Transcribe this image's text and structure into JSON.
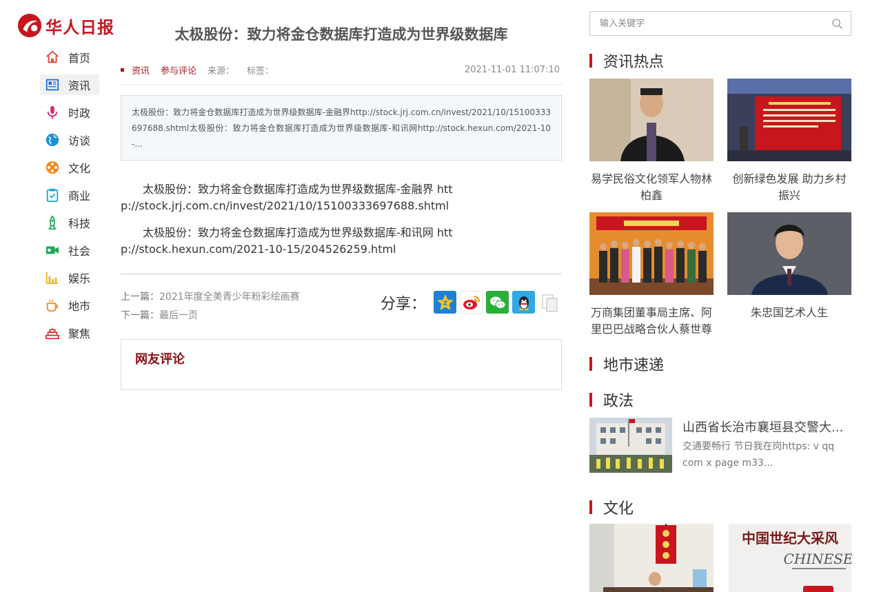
{
  "brand": {
    "name": "华人日报",
    "color": "#c8161e"
  },
  "nav": {
    "items": [
      {
        "label": "首页",
        "icon": "home-icon",
        "color": "#e2442b",
        "active": false
      },
      {
        "label": "资讯",
        "icon": "newspaper-icon",
        "color": "#1e6fd9",
        "active": true
      },
      {
        "label": "时政",
        "icon": "microphone-icon",
        "color": "#d6246e",
        "active": false
      },
      {
        "label": "访谈",
        "icon": "globe-icon",
        "color": "#1e8fd9",
        "active": false
      },
      {
        "label": "文化",
        "icon": "film-reel-icon",
        "color": "#f08a24",
        "active": false
      },
      {
        "label": "商业",
        "icon": "clipboard-check-icon",
        "color": "#1ba3d9",
        "active": false
      },
      {
        "label": "科技",
        "icon": "rocket-icon",
        "color": "#26a65b",
        "active": false
      },
      {
        "label": "社会",
        "icon": "video-camera-icon",
        "color": "#26a65b",
        "active": false
      },
      {
        "label": "娱乐",
        "icon": "bar-chart-icon",
        "color": "#e6b422",
        "active": false
      },
      {
        "label": "地市",
        "icon": "coffee-cup-icon",
        "color": "#f08a24",
        "active": false
      },
      {
        "label": "聚焦",
        "icon": "tiered-cake-icon",
        "color": "#d9262e",
        "active": false
      }
    ]
  },
  "article": {
    "title": "太极股份：致力将金仓数据库打造成为世界级数据库",
    "category": "资讯",
    "comment_link": "参与评论",
    "source_label": "来源：",
    "tags_label": "标签：",
    "date": "2021-11-01 11:07:10",
    "summary": "太极股份：致力将金仓数据库打造成为世界级数据库-金融界http://stock.jrj.com.cn/invest/2021/10/15100333697688.shtml太极股份：致力将金仓数据库打造成为世界级数据库-和讯网http://stock.hexun.com/2021-10-...",
    "paragraphs": [
      "太极股份：致力将金仓数据库打造成为世界级数据库-金融界 http://stock.jrj.com.cn/invest/2021/10/15100333697688.shtml",
      "太极股份：致力将金仓数据库打造成为世界级数据库-和讯网 http://stock.hexun.com/2021-10-15/204526259.html"
    ],
    "prev_label": "上一篇：",
    "prev_title": "2021年度全美青少年粉彩绘画赛",
    "next_label": "下一篇：",
    "next_title": "最后一页",
    "share_label": "分享：",
    "share_buttons": [
      "qzone-icon",
      "weibo-icon",
      "wechat-icon",
      "qq-icon",
      "copy-icon"
    ],
    "comments_title": "网友评论"
  },
  "search": {
    "placeholder": "输入关键字"
  },
  "hot": {
    "title": "资讯热点",
    "items": [
      {
        "caption": "易学民俗文化领军人物林柏鑫"
      },
      {
        "caption": "创新绿色发展 助力乡村振兴"
      },
      {
        "caption": "万商集团董事局主席、阿里巴巴战略合伙人蔡世尊"
      },
      {
        "caption": "朱忠国艺术人生"
      }
    ]
  },
  "city": {
    "title": "地市速递"
  },
  "politics": {
    "title": "政法",
    "item": {
      "title": "山西省长治市襄垣县交警大...",
      "summary": "交通要畅行 节日我在岗https: v qq com x page m33..."
    }
  },
  "culture": {
    "title": "文化",
    "poster_text": "中国世纪大采风",
    "poster_sub": "CHINESE"
  }
}
